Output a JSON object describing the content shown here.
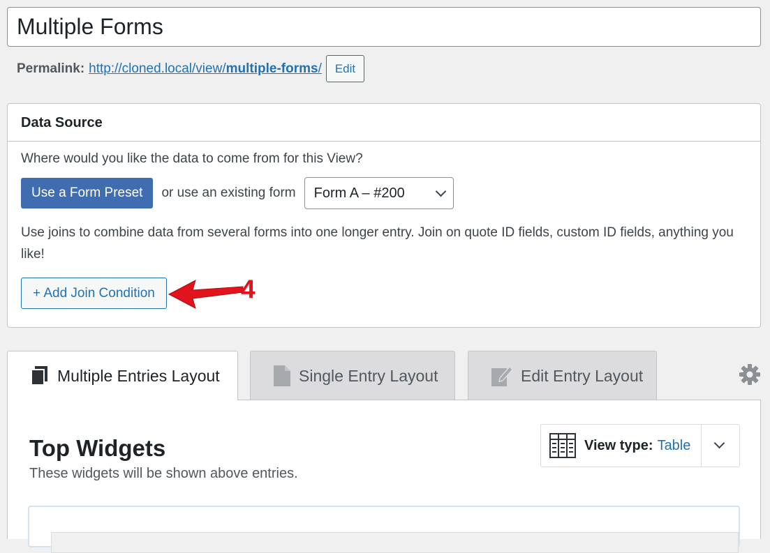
{
  "post_title": "Multiple Forms",
  "permalink": {
    "label": "Permalink:",
    "url_prefix": "http://cloned.local/view/",
    "slug": "multiple-forms",
    "url_suffix": "/",
    "edit_label": "Edit"
  },
  "data_source": {
    "heading": "Data Source",
    "question": "Where would you like the data to come from for this View?",
    "preset_button": "Use a Form Preset",
    "or_text": "or use an existing form",
    "selected_form": "Form A – #200",
    "joins_help": "Use joins to combine data from several forms into one longer entry. Join on quote ID fields, custom ID fields, anything you like!",
    "add_join_button": "+ Add Join Condition",
    "annotation_number": "4",
    "annotation_color": "#e1131c"
  },
  "tabs": [
    {
      "label": "Multiple Entries Layout",
      "icon": "multiple-entries-icon",
      "active": true
    },
    {
      "label": "Single Entry Layout",
      "icon": "document-icon",
      "active": false
    },
    {
      "label": "Edit Entry Layout",
      "icon": "edit-document-icon",
      "active": false
    }
  ],
  "top_widgets": {
    "title": "Top Widgets",
    "description": "These widgets will be shown above entries."
  },
  "view_type": {
    "label": "View type:",
    "value": "Table"
  },
  "colors": {
    "primary_button": "#3f6daf",
    "link": "#2271b1"
  }
}
